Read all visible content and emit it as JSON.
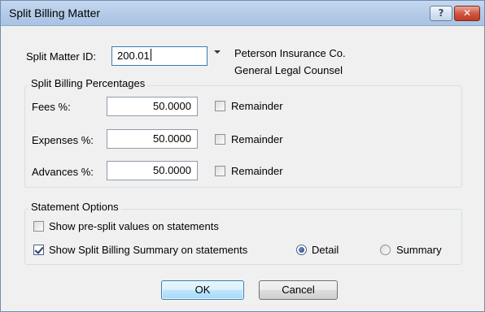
{
  "window": {
    "title": "Split Billing Matter",
    "help_glyph": "?",
    "close_glyph": "✕"
  },
  "matter": {
    "id_label": "Split Matter ID:",
    "id_value": "200.01",
    "client_name": "Peterson Insurance Co.",
    "matter_description": "General Legal Counsel"
  },
  "percentages": {
    "group_title": "Split Billing Percentages",
    "rows": [
      {
        "label": "Fees %:",
        "value": "50.0000",
        "remainder_label": "Remainder",
        "remainder_checked": false
      },
      {
        "label": "Expenses %:",
        "value": "50.0000",
        "remainder_label": "Remainder",
        "remainder_checked": false
      },
      {
        "label": "Advances %:",
        "value": "50.0000",
        "remainder_label": "Remainder",
        "remainder_checked": false
      }
    ]
  },
  "statement_options": {
    "group_title": "Statement Options",
    "show_pre_split_label": "Show pre-split values on statements",
    "show_pre_split_checked": false,
    "show_summary_label": "Show Split Billing Summary on statements",
    "show_summary_checked": true,
    "detail_label": "Detail",
    "summary_label": "Summary",
    "selected_mode": "Detail"
  },
  "buttons": {
    "ok_label": "OK",
    "cancel_label": "Cancel"
  },
  "icons": {
    "help": "help-icon",
    "close": "close-icon",
    "dropdown": "chevron-down-icon"
  },
  "colors": {
    "titlebar": "#b9cfea",
    "close_button": "#c8472f",
    "dialog_background": "#f0f0f0",
    "default_button_border": "#3c7fb1"
  }
}
